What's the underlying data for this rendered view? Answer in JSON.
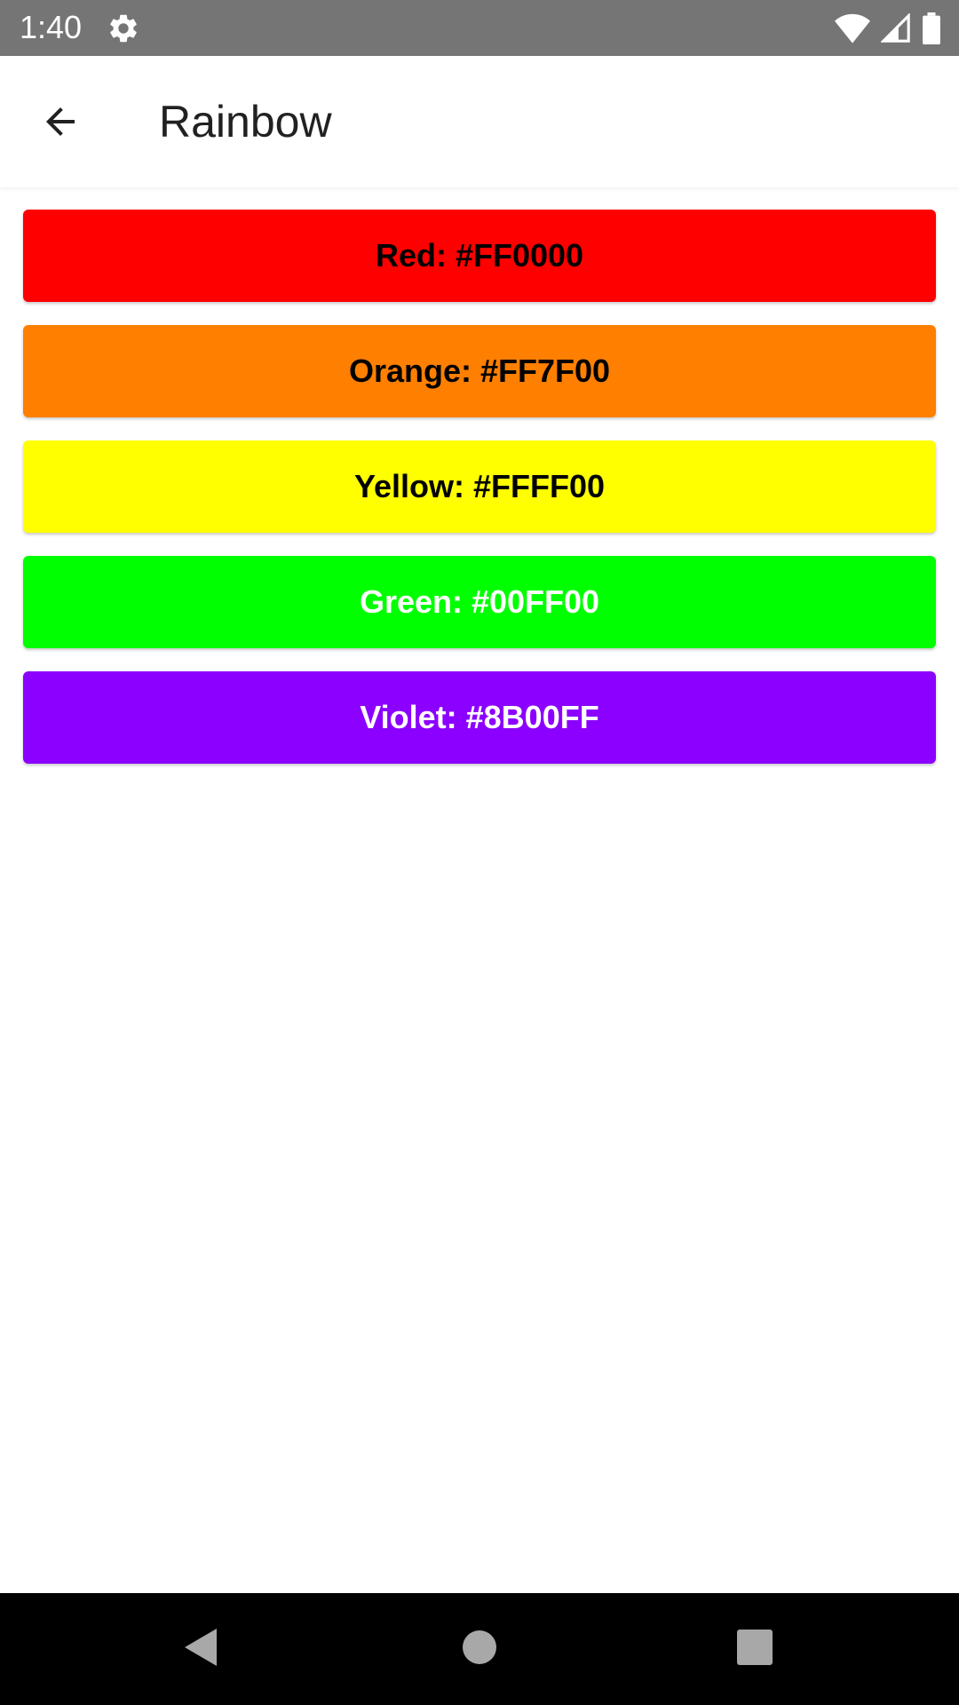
{
  "status_bar": {
    "time": "1:40",
    "background": "#757575",
    "icons": [
      "gear-icon",
      "wifi-icon",
      "signal-icon",
      "battery-icon"
    ]
  },
  "app_bar": {
    "title": "Rainbow",
    "back_icon": "arrow-back-icon"
  },
  "colors": [
    {
      "label": "Red: #FF0000",
      "color": "#FF0000",
      "text_color": "#000000"
    },
    {
      "label": "Orange: #FF7F00",
      "color": "#FF7F00",
      "text_color": "#000000"
    },
    {
      "label": "Yellow: #FFFF00",
      "color": "#FFFF00",
      "text_color": "#000000"
    },
    {
      "label": "Green: #00FF00",
      "color": "#00FF00",
      "text_color": "#FFFFFF"
    },
    {
      "label": "Violet: #8B00FF",
      "color": "#8B00FF",
      "text_color": "#FFFFFF"
    }
  ],
  "nav_bar": {
    "icons": [
      "back-triangle-icon",
      "home-circle-icon",
      "recents-square-icon"
    ],
    "background": "#000000"
  }
}
